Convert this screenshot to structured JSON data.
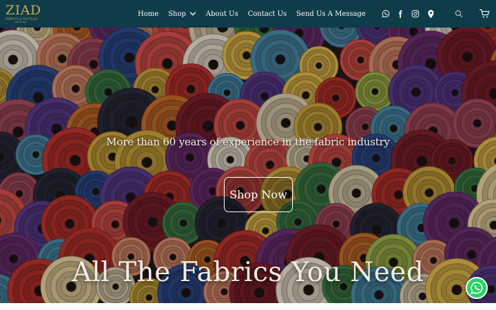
{
  "brand": {
    "logo_word": "ZIAD",
    "logo_subtitle": "FABRICS & TEXTILES",
    "logo_tagline": "SINCE 1960",
    "gold": "#c9a84a",
    "header_bg": "#0e3c49"
  },
  "nav": {
    "items": [
      {
        "label": "Home"
      },
      {
        "label": "Shop",
        "has_dropdown": true
      },
      {
        "label": "About Us"
      },
      {
        "label": "Contact Us"
      },
      {
        "label": "Send Us A Message"
      }
    ]
  },
  "header_icons": [
    "whatsapp-icon",
    "facebook-icon",
    "instagram-icon",
    "location-pin-icon",
    "search-icon",
    "cart-icon"
  ],
  "hero": {
    "tagline": "More than 60 years of experience in the fabric industry",
    "cta_label": "Shop Now",
    "headline": "All The Fabrics You Need"
  },
  "floating": {
    "whatsapp_color": "#25d366"
  }
}
